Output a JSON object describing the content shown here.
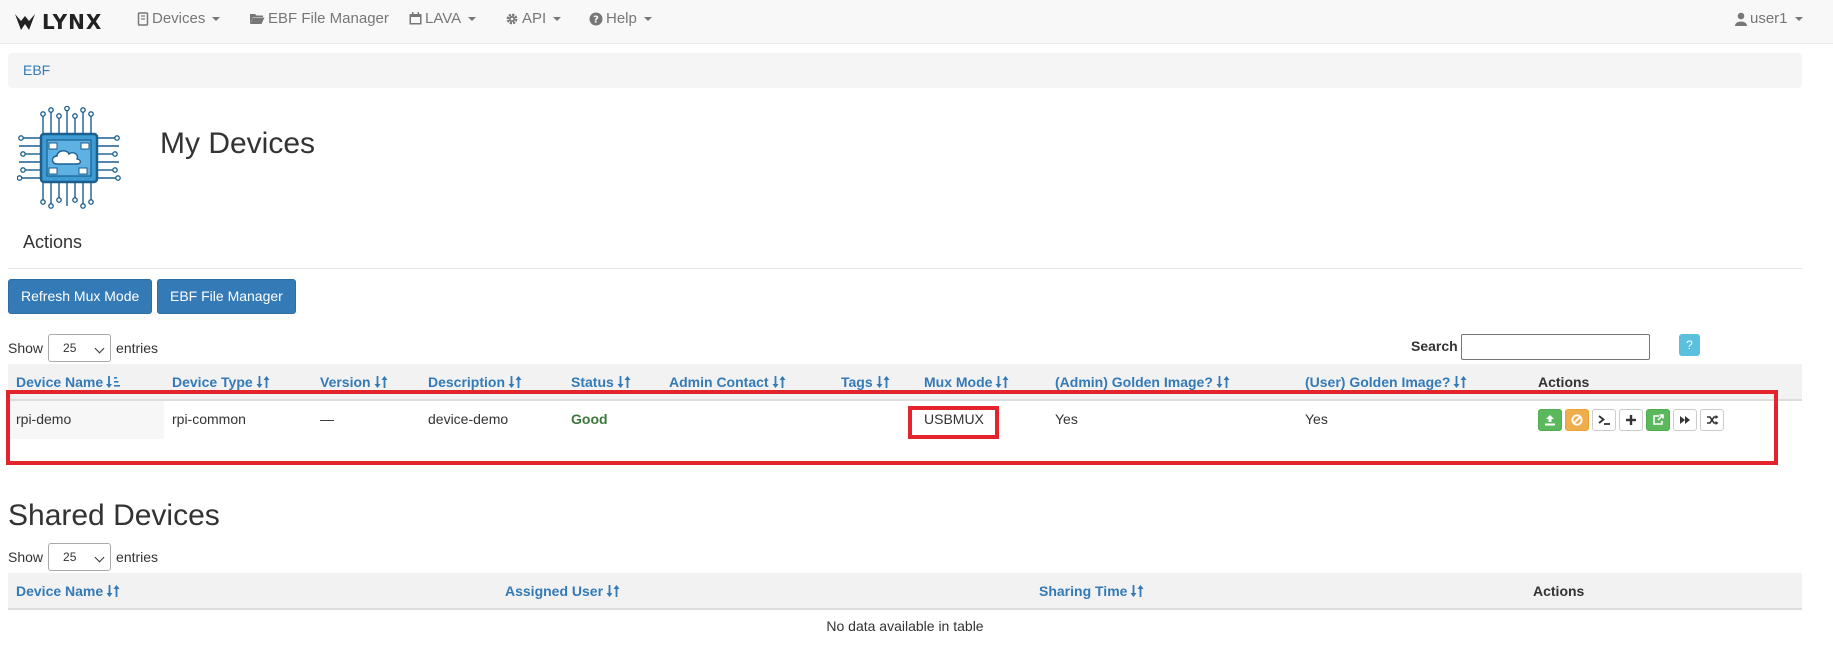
{
  "navbar": {
    "brand": "LYNX",
    "items": [
      {
        "label": "Devices",
        "icon": "device-icon",
        "dropdown": true
      },
      {
        "label": "EBF File Manager",
        "icon": "folder-open-icon",
        "dropdown": false
      },
      {
        "label": "LAVA",
        "icon": "calendar-icon",
        "dropdown": true
      },
      {
        "label": "API",
        "icon": "gear-icon",
        "dropdown": true
      },
      {
        "label": "Help",
        "icon": "question-circle-icon",
        "dropdown": true
      }
    ],
    "user": {
      "label": "user1",
      "icon": "user-icon"
    }
  },
  "breadcrumb": {
    "items": [
      "EBF"
    ]
  },
  "page": {
    "title": "My Devices",
    "logo_icon": "chip-cloud-icon"
  },
  "actions": {
    "title": "Actions",
    "buttons": [
      "Refresh Mux Mode",
      "EBF File Manager"
    ]
  },
  "my_devices_table": {
    "length": {
      "show": "Show",
      "value": "25",
      "entries": "entries"
    },
    "search_label": "Search",
    "search_value": "",
    "help_label": "?",
    "columns": [
      "Device Name",
      "Device Type",
      "Version",
      "Description",
      "Status",
      "Admin Contact",
      "Tags",
      "Mux Mode",
      "(Admin) Golden Image?",
      "(User) Golden Image?",
      "Actions"
    ],
    "rows": [
      {
        "device_name": "rpi-demo",
        "device_type": "rpi-common",
        "version": "—",
        "description": "device-demo",
        "status": "Good",
        "admin_contact": "",
        "tags": "",
        "mux_mode": "USBMUX",
        "admin_golden_image": "Yes",
        "user_golden_image": "Yes",
        "actions": [
          {
            "icon": "upload-icon",
            "style": "green"
          },
          {
            "icon": "ban-icon",
            "style": "orange"
          },
          {
            "icon": "terminal-icon",
            "style": "white"
          },
          {
            "icon": "plus-icon",
            "style": "white"
          },
          {
            "icon": "share-icon",
            "style": "green"
          },
          {
            "icon": "fast-forward-icon",
            "style": "white"
          },
          {
            "icon": "random-icon",
            "style": "white"
          }
        ]
      }
    ]
  },
  "shared_devices": {
    "title": "Shared Devices",
    "length": {
      "show": "Show",
      "value": "25",
      "entries": "entries"
    },
    "columns": [
      "Device Name",
      "Assigned User",
      "Sharing Time",
      "Actions"
    ],
    "empty_text": "No data available in table"
  },
  "colors": {
    "accent": "#337ab7",
    "highlight": "#e3242b",
    "success": "#5cb85c",
    "warning": "#f0ad4e",
    "info": "#5bc0de"
  }
}
